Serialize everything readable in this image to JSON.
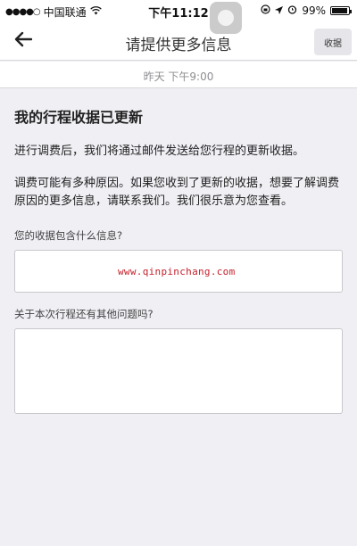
{
  "status_bar": {
    "signal": "●●●●○",
    "carrier": "中国联通",
    "wifi_icon": "wifi-icon",
    "time": "下午11:12",
    "battery_percent": "99%"
  },
  "nav": {
    "back_icon": "back-arrow-icon",
    "title": "请提供更多信息",
    "receipt_label": "收据"
  },
  "timestamp": "昨天 下午9:00",
  "content": {
    "heading": "我的行程收据已更新",
    "para1": "进行调费后，我们将通过邮件发送给您行程的更新收据。",
    "para2": "调费可能有多种原因。如果您收到了更新的收据，想要了解调费原因的更多信息，请联系我们。我们很乐意为您查看。",
    "q1_label": "您的收据包含什么信息?",
    "q1_value": "",
    "q2_label": "关于本次行程还有其他问题吗?",
    "q2_value": ""
  },
  "watermark": "www.qinpinchang.com"
}
